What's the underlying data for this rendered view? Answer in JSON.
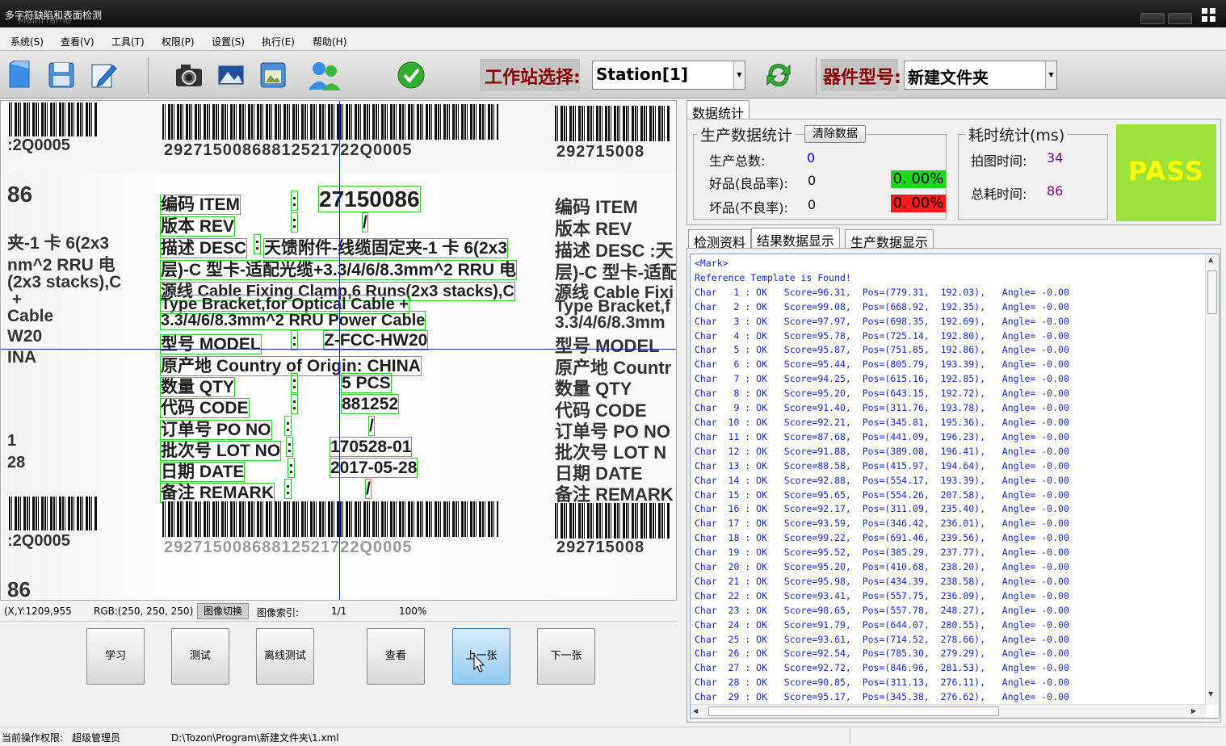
{
  "window": {
    "title": "多字符缺陷和表面检测",
    "ghost_title": "MainFrame"
  },
  "menu": [
    "系统(S)",
    "查看(V)",
    "工具(T)",
    "权限(P)",
    "设置(S)",
    "执行(E)",
    "帮助(H)"
  ],
  "toolbar": {
    "station_label": "工作站选择:",
    "station_value": "Station[1]",
    "device_label": "器件型号:",
    "device_value": "新建文件夹"
  },
  "label": {
    "top_barcode": "29271500868812521722Q0005",
    "left_top_code": ":2Q0005",
    "right_top_code": "292715008",
    "left_86": "86",
    "left_lines": [
      "夹-1 卡 6(2x3",
      "nm^2 RRU 电",
      "(2x3 stacks),C",
      "+",
      "Cable",
      "W20",
      "INA"
    ],
    "rows": [
      {
        "label": "编码 ITEM",
        "colon": ":",
        "value": "27150086"
      },
      {
        "label": "版本 REV",
        "colon": ":",
        "value": "/"
      },
      {
        "label": "描述 DESC",
        "colon": ":",
        "value": "天馈附件-线缆固定夹-1 卡 6(2x3"
      },
      {
        "label": "层)-C 型卡-适配光缆+3.3/4/6/8.3mm^2 RRU 电",
        "colon": "",
        "value": ""
      },
      {
        "label": "源线 Cable Fixing Clamp,6 Runs(2x3 stacks),C",
        "colon": "",
        "value": ""
      },
      {
        "label": "Type Bracket,for Optical Cable +",
        "colon": "",
        "value": ""
      },
      {
        "label": "3.3/4/6/8.3mm^2 RRU Power Cable",
        "colon": "",
        "value": ""
      },
      {
        "label": "型号 MODEL",
        "colon": ":",
        "value": "Z-FCC-HW20"
      },
      {
        "label": "原产地 Country of Origin: CHINA",
        "colon": "",
        "value": ""
      },
      {
        "label": "数量 QTY",
        "colon": ":",
        "value": "5 PCS"
      },
      {
        "label": "代码 CODE",
        "colon": ":",
        "value": "881252"
      },
      {
        "label": "订单号 PO NO",
        "colon": ":",
        "value": "/"
      },
      {
        "label": "批次号 LOT NO",
        "colon": ":",
        "value": "170528-01"
      },
      {
        "label": "日期 DATE",
        "colon": ":",
        "value": "2017-05-28"
      },
      {
        "label": "备注 REMARK",
        "colon": ":",
        "value": "/"
      }
    ],
    "right_lines": [
      "编码 ITEM",
      "版本 REV",
      "描述 DESC :天",
      "层)-C 型卡-适配",
      "源线 Cable Fixi",
      "Type Bracket,f",
      "3.3/4/6/8.3mm",
      "型号 MODEL",
      "原产地 Countr",
      "数量 QTY",
      "代码 CODE",
      "订单号 PO NO",
      "批次号 LOT N",
      "日期 DATE",
      "备注 REMARK"
    ],
    "left_small": [
      "1",
      "28"
    ],
    "bottom_barcode": "29271500868812521722Q0005",
    "left_bottom_code": ":2Q0005",
    "right_bottom_code": "292715008",
    "left_bottom_86": "86"
  },
  "status": {
    "coords": "(X,Y:1209,955",
    "rgb": "RGB:(250, 250, 250)",
    "switch_button": "图像切换",
    "index_label": "图像索引:",
    "index_value": "1/1",
    "zoom": "100%"
  },
  "actions": [
    "学习",
    "测试",
    "离线测试",
    "查看",
    "上一张",
    "下一张"
  ],
  "bottom": {
    "permission_label": "当前操作权限:",
    "permission_value": "超级管理员",
    "path": "D:\\Tozon\\Program\\新建文件夹\\1.xml"
  },
  "right": {
    "top_tab": "数据统计",
    "prod_title": "生产数据统计",
    "clear_button": "清除数据",
    "total_label": "生产总数:",
    "total_value": "0",
    "good_label": "好品(良品率):",
    "good_value": "0",
    "good_pct": "0. 00%",
    "bad_label": "坏品(不良率):",
    "bad_value": "0",
    "bad_pct": "0. 00%",
    "time_title": "耗时统计(ms)",
    "capture_label": "拍图时间:",
    "capture_value": "34",
    "total_time_label": "总耗时间:",
    "total_time_value": "86",
    "pass": "PASS",
    "tabs": [
      "检测资料",
      "结果数据显示",
      "生产数据显示"
    ]
  },
  "colors": {
    "good_pct_bg": "#1fd61f",
    "bad_pct_bg": "#ff1a1a",
    "pass_bg": "#9be23a",
    "pass_text": "#ffff00",
    "log_text": "#1428d8"
  },
  "log": [
    "<Mark>",
    "Reference Template is Found!",
    "Char   1 : OK   Score=96.31,  Pos=(779.31,  192.03),   Angle= -0.00",
    "Char   2 : OK   Score=99.08,  Pos=(668.92,  192.35),   Angle= -0.00",
    "Char   3 : OK   Score=97.97,  Pos=(698.35,  192.69),   Angle= -0.00",
    "Char   4 : OK   Score=95.78,  Pos=(725.14,  192.80),   Angle= -0.00",
    "Char   5 : OK   Score=95.87,  Pos=(751.85,  192.86),   Angle= -0.00",
    "Char   6 : OK   Score=95.44,  Pos=(805.79,  193.39),   Angle= -0.00",
    "Char   7 : OK   Score=94.25,  Pos=(615.16,  192.85),   Angle= -0.00",
    "Char   8 : OK   Score=95.20,  Pos=(643.15,  192.72),   Angle= -0.00",
    "Char   9 : OK   Score=91.40,  Pos=(311.76,  193.78),   Angle= -0.00",
    "Char  10 : OK   Score=92.21,  Pos=(345.81,  195.36),   Angle= -0.00",
    "Char  11 : OK   Score=87.68,  Pos=(441.09,  196.23),   Angle= -0.00",
    "Char  12 : OK   Score=91.88,  Pos=(389.08,  196.41),   Angle= -0.00",
    "Char  13 : OK   Score=88.58,  Pos=(415.97,  194.64),   Angle= -0.00",
    "Char  14 : OK   Score=92.88,  Pos=(554.17,  193.39),   Angle= -0.00",
    "Char  15 : OK   Score=95.65,  Pos=(554.26,  207.58),   Angle= -0.00",
    "Char  16 : OK   Score=92.17,  Pos=(311.09,  235.40),   Angle= -0.00",
    "Char  17 : OK   Score=93.59,  Pos=(346.42,  236.01),   Angle= -0.00",
    "Char  18 : OK   Score=99.22,  Pos=(691.46,  239.56),   Angle= -0.00",
    "Char  19 : OK   Score=95.52,  Pos=(385.29,  237.77),   Angle= -0.00",
    "Char  20 : OK   Score=95.20,  Pos=(410.68,  238.20),   Angle= -0.00",
    "Char  21 : OK   Score=95.98,  Pos=(434.39,  238.58),   Angle= -0.00",
    "Char  22 : OK   Score=93.41,  Pos=(557.75,  236.09),   Angle= -0.00",
    "Char  23 : OK   Score=98.65,  Pos=(557.78,  248.27),   Angle= -0.00",
    "Char  24 : OK   Score=91.79,  Pos=(644.07,  280.55),   Angle= -0.00",
    "Char  25 : OK   Score=93.61,  Pos=(714.52,  278.66),   Angle= -0.00",
    "Char  26 : OK   Score=92.54,  Pos=(785.30,  279.29),   Angle= -0.00",
    "Char  27 : OK   Score=92.72,  Pos=(846.96,  281.53),   Angle= -0.00",
    "Char  28 : OK   Score=90.85,  Pos=(311.13,  276.11),   Angle= -0.00",
    "Char  29 : OK   Score=95.17,  Pos=(345.38,  276.62),   Angle= -0.00"
  ]
}
